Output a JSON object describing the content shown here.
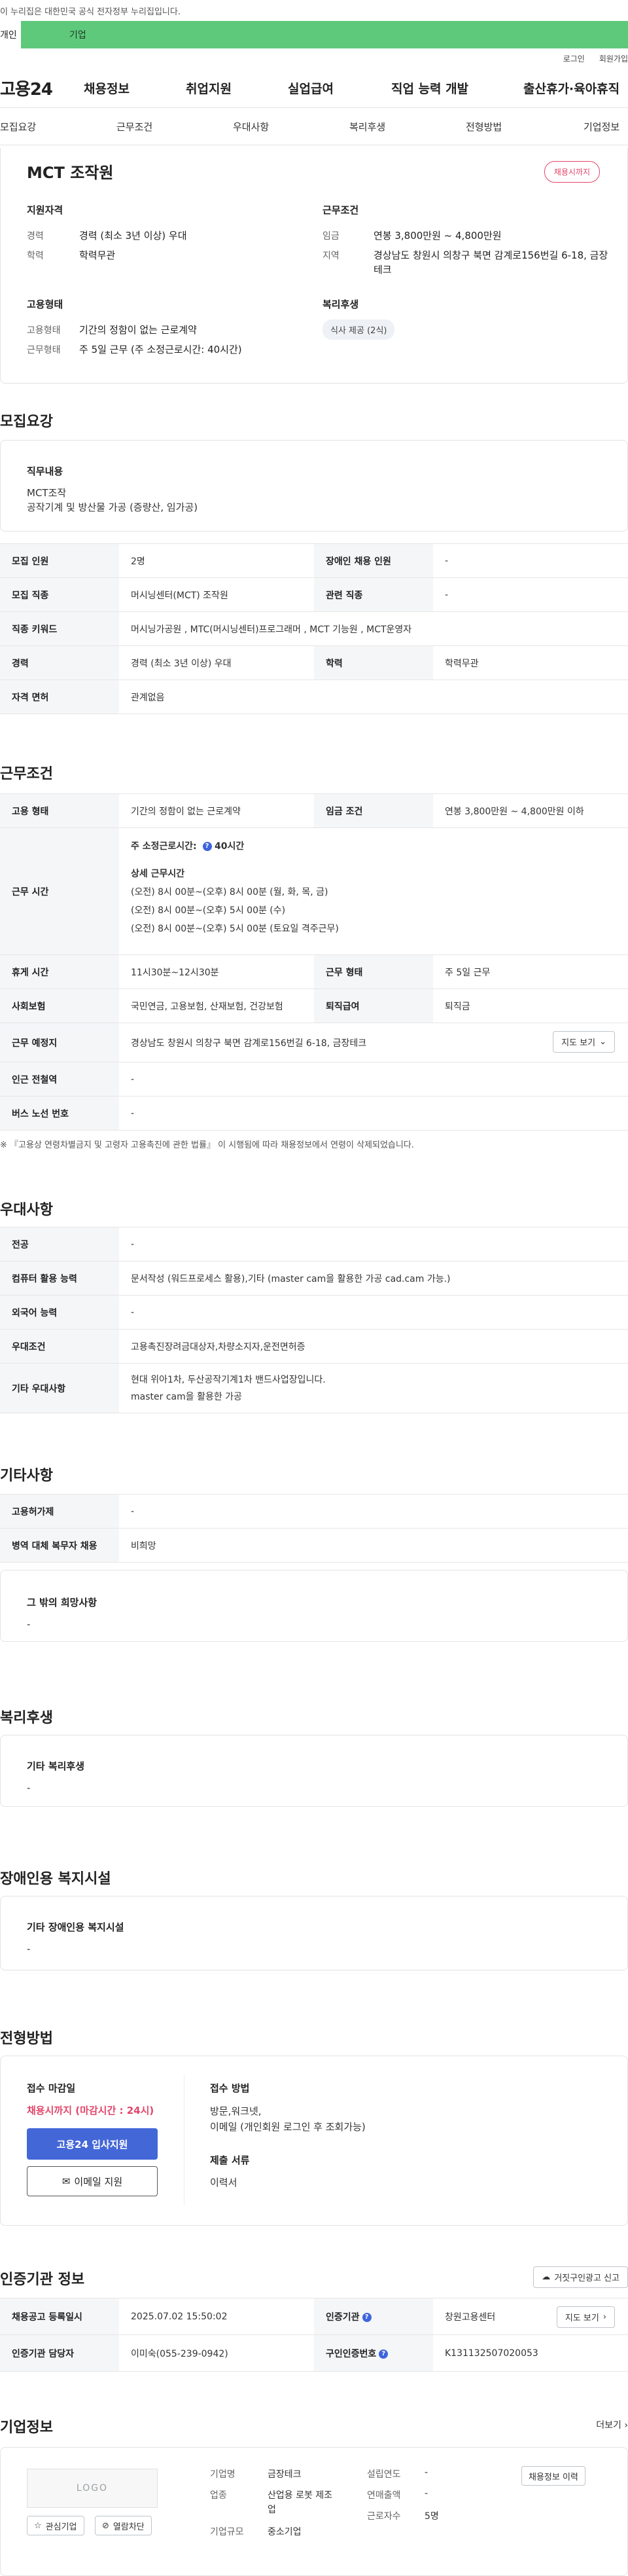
{
  "gov_banner": "이 누리집은 대한민국 공식 전자정부 누리집입니다.",
  "tabs": {
    "personal": "개인",
    "corporate": "기업"
  },
  "util": {
    "login": "로그인",
    "join": "회원가입"
  },
  "gnb": {
    "logo": "고용24",
    "menu": [
      "채용정보",
      "취업지원",
      "실업급여",
      "직업 능력 개발",
      "출산휴가·육아휴직"
    ]
  },
  "subnav": [
    "모집요강",
    "근무조건",
    "우대사항",
    "복리후생",
    "전형방법",
    "기업정보"
  ],
  "summary": {
    "title": "MCT 조작원",
    "badge": "채용시까지",
    "qual_label": "지원자격",
    "qual": [
      {
        "k": "경력",
        "v": "경력 (최소 3년 이상) 우대"
      },
      {
        "k": "학력",
        "v": "학력무관"
      }
    ],
    "cond_label": "근무조건",
    "cond": [
      {
        "k": "임금",
        "v": "연봉 3,800만원 ~ 4,800만원"
      },
      {
        "k": "지역",
        "v": "경상남도 창원시 의창구 북면 감계로156번길 6-18, 금장테크"
      }
    ],
    "emp_label": "고용형태",
    "emp": [
      {
        "k": "고용형태",
        "v": "기간의 정함이 없는 근로계약"
      },
      {
        "k": "근무형태",
        "v": "주 5일 근무 (주 소정근로시간: 40시간)"
      }
    ],
    "welfare_label": "복리후생",
    "welfare_chip": "식사 제공 (2식)"
  },
  "recruit": {
    "heading": "모집요강",
    "duty_label": "직무내용",
    "duty_lines": [
      "MCT조작",
      "공작기계 및 방산물 가공 (증량산, 임가공)"
    ],
    "rows": [
      {
        "k1": "모집 인원",
        "v1": "2명",
        "k2": "장애인 채용 인원",
        "v2": "-"
      },
      {
        "k1": "모집 직종",
        "v1": "머시닝센터(MCT) 조작원",
        "k2": "관련 직종",
        "v2": "-"
      },
      {
        "k1": "직종 키워드",
        "v1": "머시닝가공원 , MTC(머시닝센터)프로그래머 , MCT 기능원 , MCT운영자",
        "k2": "",
        "v2": ""
      },
      {
        "k1": "경력",
        "v1": "경력 (최소 3년 이상) 우대",
        "k2": "학력",
        "v2": "학력무관"
      },
      {
        "k1": "자격 면허",
        "v1": "관계없음",
        "k2": "",
        "v2": ""
      }
    ]
  },
  "work": {
    "heading": "근무조건",
    "emp_type_k": "고용 형태",
    "emp_type_v": "기간의 정함이 없는 근로계약",
    "wage_k": "임금 조건",
    "wage_v": "연봉 3,800만원 ~ 4,800만원 이하",
    "hours_k": "근무 시간",
    "hours_main": "주 소정근로시간",
    "hours_val": "40시간",
    "hours_detail_label": "상세 근무시간",
    "hours_lines": [
      "(오전) 8시 00분~(오후) 8시 00분 (월, 화, 목, 금)",
      "(오전) 8시 00분~(오후) 5시 00분 (수)",
      "(오전) 8시 00분~(오후) 5시 00분 (토요일 격주근무)"
    ],
    "break_k": "휴게 시간",
    "break_v": "11시30분~12시30분",
    "form_k": "근무 형태",
    "form_v": "주 5일 근무",
    "ins_k": "사회보험",
    "ins_v": "국민연금, 고용보험, 산재보험, 건강보험",
    "sev_k": "퇴직급여",
    "sev_v": "퇴직금",
    "loc_k": "근무 예정지",
    "loc_v": "경상남도 창원시 의창구 북면 감계로156번길 6-18, 금장테크",
    "map_btn": "지도 보기",
    "subway_k": "인근 전철역",
    "subway_v": "-",
    "bus_k": "버스 노선 번호",
    "bus_v": "-",
    "note": "※ 『고용상 연령차별금지 및 고령자 고용촉진에 관한 법률』 이 시행됨에 따라 채용정보에서 연령이 삭제되었습니다."
  },
  "pref": {
    "heading": "우대사항",
    "rows": [
      {
        "k": "전공",
        "v": "-"
      },
      {
        "k": "컴퓨터 활용 능력",
        "v": "문서작성 (워드프로세스 활용),기타 (master cam을 활용한 가공 cad.cam 가능.)"
      },
      {
        "k": "외국어 능력",
        "v": "-"
      },
      {
        "k": "우대조건",
        "v": "고용촉진장려금대상자,차량소지자,운전면허증"
      },
      {
        "k": "기타 우대사항",
        "v": "현대 위아1차, 두산공작기계1차 밴드사업장입니다.",
        "v2": "master cam을 활용한 가공"
      }
    ]
  },
  "etc": {
    "heading": "기타사항",
    "rows": [
      {
        "k": "고용허가제",
        "v": "-"
      },
      {
        "k": "병역 대체 복무자 채용",
        "v": "비희망"
      }
    ],
    "wish_label": "그 밖의 희망사항",
    "wish_value": "-"
  },
  "welfare": {
    "heading": "복리후생",
    "label": "기타 복리후생",
    "value": "-"
  },
  "disabled": {
    "heading": "장애인용 복지시설",
    "label": "기타 장애인용 복지시설",
    "value": "-"
  },
  "selection": {
    "heading": "전형방법",
    "deadline_label": "접수 마감일",
    "deadline_value": "채용시까지 (마감시간 : 24시)",
    "apply_btn": "고용24 입사지원",
    "email_btn": "이메일 지원",
    "method_label": "접수 방법",
    "method_lines": [
      "방문,워크넷,",
      "이메일 (개인회원 로그인 후 조회가능)"
    ],
    "docs_label": "제출 서류",
    "docs_value": "이력서"
  },
  "agency": {
    "heading": "인증기관 정보",
    "report_btn": "거짓구인광고 신고",
    "rows": [
      {
        "k1": "채용공고 등록일시",
        "v1": "2025.07.02 15:50:02",
        "k2": "인증기관",
        "v2": "창원고용센터",
        "btn": "지도 보기"
      },
      {
        "k1": "인증기관 담당자",
        "v1": "이미숙(055-239-0942)",
        "k2": "구인인증번호",
        "v2": "K131132507020053"
      }
    ]
  },
  "company": {
    "heading": "기업정보",
    "more": "더보기",
    "logo_text": "LOGO",
    "fav_btn": "관심기업",
    "block_btn": "열람차단",
    "hist_btn": "채용정보 이력",
    "name_k": "기업명",
    "name_v": "금장테크",
    "ind_k": "업종",
    "ind_v_lines": [
      "산업용 로봇 제조",
      "업"
    ],
    "size_k": "기업규모",
    "size_v": "중소기업",
    "year_k": "설립연도",
    "year_v": "-",
    "rev_k": "연매출액",
    "rev_v": "-",
    "emp_k": "근로자수",
    "emp_v": "5명"
  }
}
